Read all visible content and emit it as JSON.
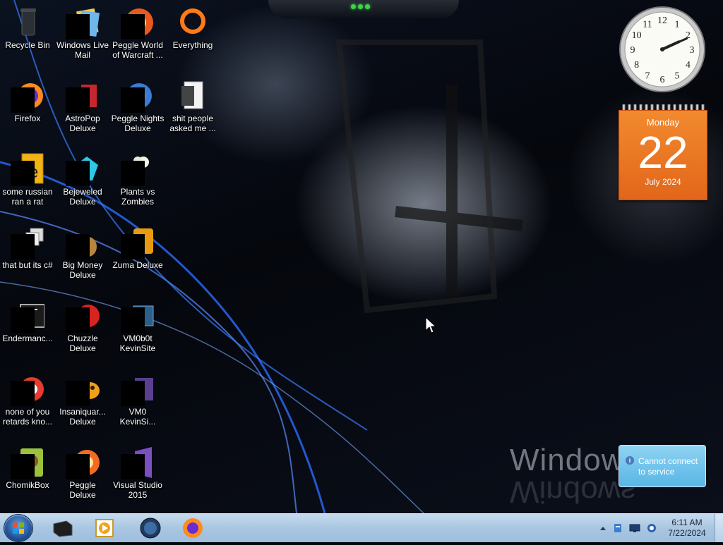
{
  "desktop_icons": [
    {
      "id": "recycle-bin",
      "label": "Recycle Bin"
    },
    {
      "id": "windows-live-mail",
      "label": "Windows Live Mail"
    },
    {
      "id": "peggle-world-of-warcraft",
      "label": "Peggle World of Warcraft ..."
    },
    {
      "id": "everything",
      "label": "Everything"
    },
    {
      "id": "firefox",
      "label": "Firefox"
    },
    {
      "id": "astropop-deluxe",
      "label": "AstroPop Deluxe"
    },
    {
      "id": "peggle-nights-deluxe",
      "label": "Peggle Nights Deluxe"
    },
    {
      "id": "shit-people-asked-me",
      "label": "shit people asked me ..."
    },
    {
      "id": "some-russian-ran-a-rat",
      "label": "some russian ran a rat"
    },
    {
      "id": "bejeweled-deluxe",
      "label": "Bejeweled Deluxe"
    },
    {
      "id": "plants-vs-zombies",
      "label": "Plants vs Zombies"
    },
    {
      "id": "that-but-its-csharp",
      "label": "that but its c#"
    },
    {
      "id": "big-money-deluxe",
      "label": "Big Money Deluxe"
    },
    {
      "id": "zuma-deluxe",
      "label": "Zuma Deluxe"
    },
    {
      "id": "endermanch",
      "label": "Endermanc..."
    },
    {
      "id": "chuzzle-deluxe",
      "label": "Chuzzle Deluxe"
    },
    {
      "id": "vm0b0t-kevinsite",
      "label": "VM0b0t KevinSite"
    },
    {
      "id": "none-of-you-retards",
      "label": "none of you retards kno..."
    },
    {
      "id": "insaniquarium-deluxe",
      "label": "Insaniquar... Deluxe"
    },
    {
      "id": "vm0-kevinsi",
      "label": "VM0 KevinSi..."
    },
    {
      "id": "chomikbox",
      "label": "ChomikBox"
    },
    {
      "id": "peggle-deluxe",
      "label": "Peggle Deluxe"
    },
    {
      "id": "visual-studio-2015",
      "label": "Visual Studio 2015"
    }
  ],
  "clock_gadget": {
    "numbers": [
      "12",
      "1",
      "2",
      "3",
      "4",
      "5",
      "6",
      "7",
      "8",
      "9",
      "10",
      "11"
    ],
    "hour": 2,
    "minute": 11
  },
  "calendar_gadget": {
    "weekday": "Monday",
    "day": "22",
    "month_year": "July 2024",
    "accent_color": "#e8701f"
  },
  "notification_gadget": {
    "icon": "info-icon",
    "text": "Cannot connect to service"
  },
  "watermark": {
    "text": "Windows"
  },
  "taskbar": {
    "start_icon": "windows-orb-icon",
    "pinned": [
      {
        "id": "taskbar-terminal",
        "icon": "terminal-icon"
      },
      {
        "id": "taskbar-media-player",
        "icon": "media-player-icon"
      },
      {
        "id": "taskbar-globe",
        "icon": "globe-icon"
      },
      {
        "id": "taskbar-firefox",
        "icon": "firefox-icon"
      }
    ],
    "tray": {
      "icons": [
        "show-hidden-icons-arrow",
        "action-center-icon",
        "monitor-icon",
        "network-icon"
      ],
      "time": "6:11 AM",
      "date": "7/22/2024"
    }
  }
}
